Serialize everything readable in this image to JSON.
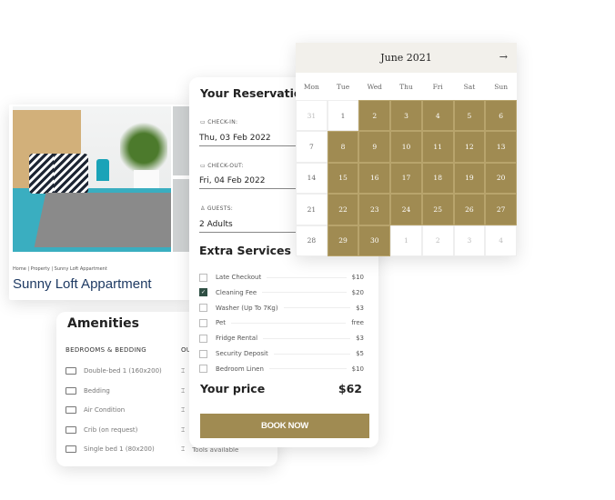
{
  "listing": {
    "breadcrumb": "Home | Property | Sunny Loft Appartment",
    "title": "Sunny Loft Appartment"
  },
  "amenities": {
    "title": "Amenities",
    "col1_header": "BEDROOMS & BEDDING",
    "col2_header": "OU",
    "items": [
      {
        "label": "Double-bed 1 (160x200)",
        "icon": "double-bed-icon"
      },
      {
        "label": "Bedding",
        "icon": "bedding-icon"
      },
      {
        "label": "Air Condition",
        "icon": "air-condition-icon"
      },
      {
        "label": "Crib (on request)",
        "icon": "crib-icon"
      },
      {
        "label": "Single bed 1 (80x200)",
        "icon": "single-bed-icon"
      }
    ],
    "col2_items": [
      {
        "label": "",
        "icon": "lamp-icon"
      },
      {
        "label": "",
        "icon": "tv-icon"
      },
      {
        "label": "",
        "icon": "hairdryer-icon"
      },
      {
        "label": "",
        "icon": "grill-icon"
      },
      {
        "label": "Tools available",
        "icon": "tools-icon"
      }
    ]
  },
  "reservation": {
    "title": "Your Reservation",
    "checkin_label": "CHECK-IN:",
    "checkin_value": "Thu, 03 Feb 2022",
    "checkout_label": "CHECK-OUT:",
    "checkout_value": "Fri, 04 Feb 2022",
    "guests_label": "GUESTS:",
    "guests_value": "2 Adults",
    "extra_title": "Extra Services",
    "services": [
      {
        "label": "Late Checkout",
        "price": "$10",
        "checked": false
      },
      {
        "label": "Cleaning Fee",
        "price": "$20",
        "checked": true
      },
      {
        "label": "Washer (Up To 7Kg)",
        "price": "$3",
        "checked": false
      },
      {
        "label": "Pet",
        "price": "free",
        "checked": false
      },
      {
        "label": "Fridge Rental",
        "price": "$3",
        "checked": false
      },
      {
        "label": "Security Deposit",
        "price": "$5",
        "checked": false
      },
      {
        "label": "Bedroom Linen",
        "price": "$10",
        "checked": false
      }
    ],
    "price_label": "Your price",
    "price_value": "$62",
    "book_label": "BOOK NOW"
  },
  "calendar": {
    "month": "June 2021",
    "next_icon": "arrow-right-icon",
    "days": [
      "Mon",
      "Tue",
      "Wed",
      "Thu",
      "Fri",
      "Sat",
      "Sun"
    ],
    "cells": [
      [
        "31",
        "dim"
      ],
      [
        "1",
        ""
      ],
      [
        "2",
        "sel"
      ],
      [
        "3",
        "sel"
      ],
      [
        "4",
        "sel"
      ],
      [
        "5",
        "sel"
      ],
      [
        "6",
        "sel"
      ],
      [
        "7",
        ""
      ],
      [
        "8",
        "sel"
      ],
      [
        "9",
        "sel"
      ],
      [
        "10",
        "sel"
      ],
      [
        "11",
        "sel"
      ],
      [
        "12",
        "sel"
      ],
      [
        "13",
        "sel"
      ],
      [
        "14",
        ""
      ],
      [
        "15",
        "sel"
      ],
      [
        "16",
        "sel"
      ],
      [
        "17",
        "sel"
      ],
      [
        "18",
        "sel"
      ],
      [
        "19",
        "sel"
      ],
      [
        "20",
        "sel"
      ],
      [
        "21",
        ""
      ],
      [
        "22",
        "sel"
      ],
      [
        "23",
        "sel"
      ],
      [
        "24",
        "sel"
      ],
      [
        "25",
        "sel"
      ],
      [
        "26",
        "sel"
      ],
      [
        "27",
        "sel"
      ],
      [
        "28",
        ""
      ],
      [
        "29",
        "sel"
      ],
      [
        "30",
        "sel"
      ],
      [
        "1",
        "dim"
      ],
      [
        "2",
        "dim"
      ],
      [
        "3",
        "dim"
      ],
      [
        "4",
        "dim"
      ]
    ]
  },
  "colors": {
    "accent": "#a08b52",
    "title_blue": "#1e3a63",
    "checkbox": "#2f4f44"
  }
}
